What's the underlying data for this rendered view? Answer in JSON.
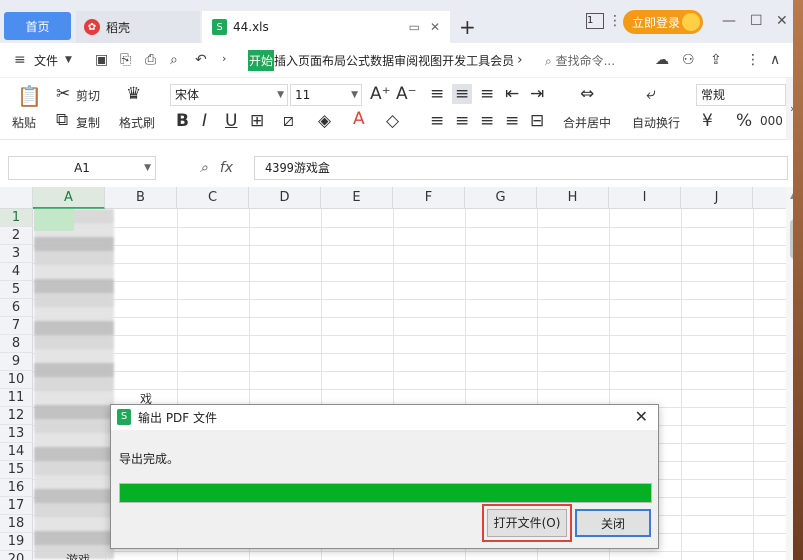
{
  "tabs": {
    "home": "首页",
    "docer": "稻壳",
    "docer_icon": "docer-logo",
    "file": "44.xls",
    "file_icon": "S"
  },
  "window": {
    "page_indicator": "1",
    "login": "立即登录"
  },
  "menu": {
    "file": "文件",
    "ribbon_tabs": [
      "开始",
      "插入",
      "页面布局",
      "公式",
      "数据",
      "审阅",
      "视图",
      "开发工具",
      "会员"
    ],
    "active_tab": "开始",
    "search": "查找命令..."
  },
  "ribbon": {
    "paste": "粘贴",
    "cut": "剪切",
    "copy": "复制",
    "format_painter": "格式刷",
    "font_name": "宋体",
    "font_size": "11",
    "merge_center": "合并居中",
    "wrap_text": "自动换行",
    "number_format": "常规",
    "currency": "¥",
    "percent": "%",
    "thousands": "000"
  },
  "formula_bar": {
    "cell_ref": "A1",
    "fx": "fx",
    "content": "4399游戏盒"
  },
  "grid": {
    "columns": [
      "A",
      "B",
      "C",
      "D",
      "E",
      "F",
      "G",
      "H",
      "I",
      "J"
    ],
    "rows": [
      "1",
      "2",
      "3",
      "4",
      "5",
      "6",
      "7",
      "8",
      "9",
      "10",
      "11",
      "12",
      "13",
      "14",
      "15",
      "16",
      "17",
      "18",
      "19",
      "20"
    ],
    "selected_col": "A",
    "selected_row": "1",
    "stray_text_1": "戏",
    "stray_text_2": "游戏"
  },
  "dialog": {
    "icon": "S",
    "title": "输出 PDF 文件",
    "message": "导出完成。",
    "progress": 1.0,
    "open_file": "打开文件(O)",
    "close": "关闭"
  },
  "colors": {
    "accent": "#1fa85a",
    "home_tab": "#4c8ef0",
    "login": "#f39a16",
    "progress": "#06b025",
    "highlight": "#d9453b"
  }
}
